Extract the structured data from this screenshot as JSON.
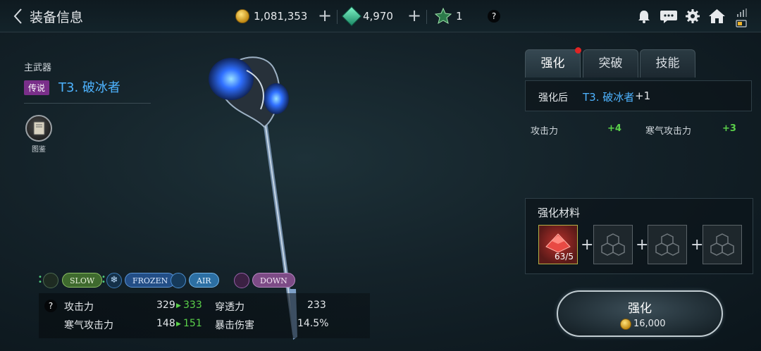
{
  "header": {
    "back_icon": "chevron-left-icon",
    "title": "装备信息",
    "gold": "1,081,353",
    "gems": "4,970",
    "tokens": "1",
    "help": "?"
  },
  "weapon": {
    "slot_label": "主武器",
    "rarity": "传说",
    "name": "T3. 破冰者",
    "codex_label": "图鉴"
  },
  "tags": [
    {
      "label": "SLOW"
    },
    {
      "label": "FROZEN"
    },
    {
      "label": "AIR"
    },
    {
      "label": "DOWN"
    }
  ],
  "stats": {
    "help": "?",
    "atk_label": "攻击力",
    "atk_cur": "329",
    "atk_new": "333",
    "pen_label": "穿透力",
    "pen_val": "233",
    "cold_label": "寒气攻击力",
    "cold_cur": "148",
    "cold_new": "151",
    "crit_label": "暴击伤害",
    "crit_val": "14.5%"
  },
  "tabs": [
    {
      "label": "强化"
    },
    {
      "label": "突破"
    },
    {
      "label": "技能"
    }
  ],
  "enhance": {
    "after_label": "强化后",
    "after_name": "T3. 破冰者",
    "after_level": "+1",
    "atk_label": "攻击力",
    "atk_gain": "+4",
    "cold_label": "寒气攻击力",
    "cold_gain": "+3",
    "materials_title": "强化材料",
    "material_count": "63/5",
    "button_label": "强化",
    "cost": "16,000"
  },
  "colors": {
    "accent_blue": "#4eb3ff",
    "stat_green": "#5bd14a",
    "legend_purple": "#7a2f8a",
    "notify_red": "#e02424"
  }
}
